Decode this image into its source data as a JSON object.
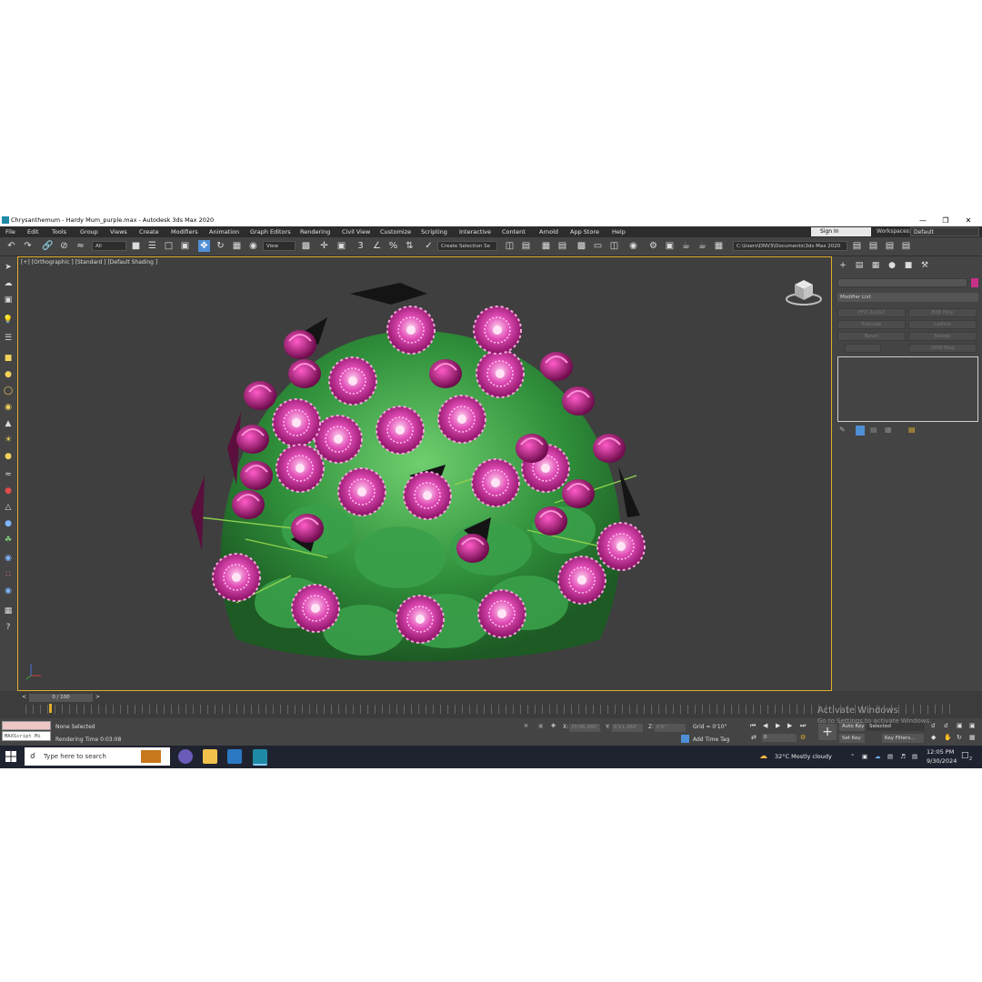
{
  "window": {
    "title": "Chrysanthemum - Hardy Mum_purple.max - Autodesk 3ds Max 2020",
    "controls": [
      "—",
      "❐",
      "✕"
    ]
  },
  "menu": {
    "items": [
      "File",
      "Edit",
      "Tools",
      "Group",
      "Views",
      "Create",
      "Modifiers",
      "Animation",
      "Graph Editors",
      "Rendering",
      "Civil View",
      "Customize",
      "Scripting",
      "Interactive",
      "Content",
      "Arnold",
      "App Store",
      "Help"
    ],
    "sign_in": "Sign In",
    "workspaces_label": "Workspaces:",
    "workspaces_value": "Default"
  },
  "toolbar": {
    "selection_filter": "All",
    "ref_coord": "View",
    "selection_set": "Create Selection Se",
    "project_path": "C:\\Users\\DNV3\\Documents\\3ds Max 2020"
  },
  "viewport": {
    "label": "[+] [Orthographic ] [Standard ] [Default Shading ]"
  },
  "command_panel": {
    "modifier_list": "Modifier List",
    "buttons": [
      "FFD 2x2x2",
      "Edit Poly",
      "Extrude",
      "Lattice",
      "Bevel",
      "Sweep",
      "",
      "UVW Map"
    ]
  },
  "timeline": {
    "frame": "0 / 100",
    "prev": "<",
    "next": ">"
  },
  "status": {
    "maxscript": "MAXScript Mi",
    "selection": "None Selected",
    "render_time": "Rendering Time  0:03:08",
    "x_label": "X:",
    "x_value": "25'06.380'",
    "y_label": "Y:",
    "y_value": "0'11.360'",
    "z_label": "Z:",
    "z_value": "0'0\"",
    "grid": "Grid = 0'10\"",
    "add_time_tag": "Add Time Tag",
    "auto_key": "Auto Key",
    "selected": "Selected",
    "set_key": "Set Key",
    "key_filters": "Key Filters...",
    "frame_value": "0"
  },
  "watermark": {
    "title": "Activate Windows",
    "subtitle": "Go to Settings to activate Windows."
  },
  "taskbar": {
    "search": "Type here to search",
    "weather": "32°C  Mostly cloudy",
    "time": "12:05 PM",
    "date": "9/30/2024",
    "notifications": "2"
  },
  "colors": {
    "accent": "#4f8fd6",
    "viewport_border": "#e0b02a",
    "flower": "#d6249b",
    "leaf": "#2f8f3a"
  }
}
